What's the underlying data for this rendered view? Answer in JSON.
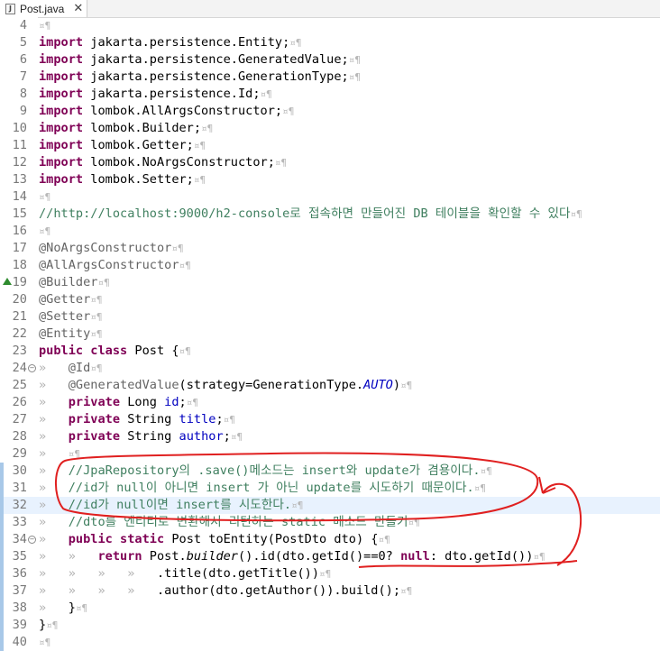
{
  "tab": {
    "title": "Post.java",
    "close_glyph": "✕",
    "icon": "java-file-icon"
  },
  "code_lines": [
    {
      "n": "4",
      "fold": false,
      "segments": []
    },
    {
      "n": "5",
      "fold": false,
      "segments": [
        {
          "t": "import",
          "c": "kw"
        },
        {
          "t": " jakarta.persistence.Entity;"
        }
      ]
    },
    {
      "n": "6",
      "fold": false,
      "segments": [
        {
          "t": "import",
          "c": "kw"
        },
        {
          "t": " jakarta.persistence.GeneratedValue;"
        }
      ]
    },
    {
      "n": "7",
      "fold": false,
      "segments": [
        {
          "t": "import",
          "c": "kw"
        },
        {
          "t": " jakarta.persistence.GenerationType;"
        }
      ]
    },
    {
      "n": "8",
      "fold": false,
      "segments": [
        {
          "t": "import",
          "c": "kw"
        },
        {
          "t": " jakarta.persistence.Id;"
        }
      ]
    },
    {
      "n": "9",
      "fold": false,
      "segments": [
        {
          "t": "import",
          "c": "kw"
        },
        {
          "t": " lombok.AllArgsConstructor;"
        }
      ]
    },
    {
      "n": "10",
      "fold": false,
      "segments": [
        {
          "t": "import",
          "c": "kw"
        },
        {
          "t": " lombok.Builder;"
        }
      ]
    },
    {
      "n": "11",
      "fold": false,
      "segments": [
        {
          "t": "import",
          "c": "kw"
        },
        {
          "t": " lombok.Getter;"
        }
      ]
    },
    {
      "n": "12",
      "fold": false,
      "segments": [
        {
          "t": "import",
          "c": "kw"
        },
        {
          "t": " lombok.NoArgsConstructor;"
        }
      ]
    },
    {
      "n": "13",
      "fold": false,
      "segments": [
        {
          "t": "import",
          "c": "kw"
        },
        {
          "t": " lombok.Setter;"
        }
      ]
    },
    {
      "n": "14",
      "fold": false,
      "segments": []
    },
    {
      "n": "15",
      "fold": false,
      "segments": [
        {
          "t": "//http://localhost:9000/h2-console로 접속하면 만들어진 DB 테이블을 확인할 수 있다",
          "c": "cm"
        }
      ]
    },
    {
      "n": "16",
      "fold": false,
      "segments": []
    },
    {
      "n": "17",
      "fold": false,
      "segments": [
        {
          "t": "@NoArgsConstructor",
          "c": "an"
        }
      ]
    },
    {
      "n": "18",
      "fold": false,
      "segments": [
        {
          "t": "@AllArgsConstructor",
          "c": "an"
        }
      ]
    },
    {
      "n": "19",
      "fold": false,
      "override": true,
      "segments": [
        {
          "t": "@Builder",
          "c": "an"
        }
      ]
    },
    {
      "n": "20",
      "fold": false,
      "segments": [
        {
          "t": "@Getter",
          "c": "an"
        }
      ]
    },
    {
      "n": "21",
      "fold": false,
      "segments": [
        {
          "t": "@Setter",
          "c": "an"
        }
      ]
    },
    {
      "n": "22",
      "fold": false,
      "segments": [
        {
          "t": "@Entity",
          "c": "an"
        }
      ]
    },
    {
      "n": "23",
      "fold": false,
      "segments": [
        {
          "t": "public",
          "c": "kw"
        },
        {
          "t": " "
        },
        {
          "t": "class",
          "c": "kw"
        },
        {
          "t": " Post {"
        }
      ]
    },
    {
      "n": "24",
      "fold": true,
      "segments": [
        {
          "t": "»   ",
          "c": "ws"
        },
        {
          "t": "@Id",
          "c": "an"
        }
      ]
    },
    {
      "n": "25",
      "fold": false,
      "segments": [
        {
          "t": "»   ",
          "c": "ws"
        },
        {
          "t": "@GeneratedValue",
          "c": "an"
        },
        {
          "t": "(strategy=GenerationType."
        },
        {
          "t": "AUTO",
          "c": "fd it"
        },
        {
          "t": ")"
        }
      ]
    },
    {
      "n": "26",
      "fold": false,
      "segments": [
        {
          "t": "»   ",
          "c": "ws"
        },
        {
          "t": "private",
          "c": "kw"
        },
        {
          "t": " Long "
        },
        {
          "t": "id",
          "c": "fd"
        },
        {
          "t": ";"
        }
      ]
    },
    {
      "n": "27",
      "fold": false,
      "segments": [
        {
          "t": "»   ",
          "c": "ws"
        },
        {
          "t": "private",
          "c": "kw"
        },
        {
          "t": " String "
        },
        {
          "t": "title",
          "c": "fd"
        },
        {
          "t": ";"
        }
      ]
    },
    {
      "n": "28",
      "fold": false,
      "segments": [
        {
          "t": "»   ",
          "c": "ws"
        },
        {
          "t": "private",
          "c": "kw"
        },
        {
          "t": " String "
        },
        {
          "t": "author",
          "c": "fd"
        },
        {
          "t": ";"
        }
      ]
    },
    {
      "n": "29",
      "fold": false,
      "segments": [
        {
          "t": "»   ",
          "c": "ws"
        }
      ]
    },
    {
      "n": "30",
      "fold": false,
      "changed": true,
      "segments": [
        {
          "t": "»   ",
          "c": "ws"
        },
        {
          "t": "//JpaRepository의 .save()메소드는 insert와 update가 겸용이다.",
          "c": "cm"
        }
      ]
    },
    {
      "n": "31",
      "fold": false,
      "changed": true,
      "segments": [
        {
          "t": "»   ",
          "c": "ws"
        },
        {
          "t": "//id가 null이 아니면 insert 가 아닌 update를 시도하기 때문이다.",
          "c": "cm"
        }
      ]
    },
    {
      "n": "32",
      "fold": false,
      "changed": true,
      "current": true,
      "segments": [
        {
          "t": "»   ",
          "c": "ws"
        },
        {
          "t": "//id가 null이면 insert를 시도한다.",
          "c": "cm"
        }
      ]
    },
    {
      "n": "33",
      "fold": false,
      "changed": true,
      "segments": [
        {
          "t": "»   ",
          "c": "ws"
        },
        {
          "t": "//dto를 엔티티로 변환해서 리턴하는 static 메소드 만들기",
          "c": "cm"
        }
      ]
    },
    {
      "n": "34",
      "fold": true,
      "changed": true,
      "segments": [
        {
          "t": "»   ",
          "c": "ws"
        },
        {
          "t": "public",
          "c": "kw"
        },
        {
          "t": " "
        },
        {
          "t": "static",
          "c": "kw"
        },
        {
          "t": " Post toEntity(PostDto dto) {"
        }
      ]
    },
    {
      "n": "35",
      "fold": false,
      "changed": true,
      "segments": [
        {
          "t": "»   »   ",
          "c": "ws"
        },
        {
          "t": "return",
          "c": "kw"
        },
        {
          "t": " Post."
        },
        {
          "t": "builder",
          "c": "it"
        },
        {
          "t": "().id(dto.getId()==0? "
        },
        {
          "t": "null",
          "c": "kw"
        },
        {
          "t": ": dto.getId())"
        }
      ]
    },
    {
      "n": "36",
      "fold": false,
      "changed": true,
      "segments": [
        {
          "t": "»   »   »   »   ",
          "c": "ws"
        },
        {
          "t": ".title(dto.getTitle())"
        }
      ]
    },
    {
      "n": "37",
      "fold": false,
      "changed": true,
      "segments": [
        {
          "t": "»   »   »   »   ",
          "c": "ws"
        },
        {
          "t": ".author(dto.getAuthor()).build();"
        }
      ]
    },
    {
      "n": "38",
      "fold": false,
      "changed": true,
      "segments": [
        {
          "t": "»   ",
          "c": "ws"
        },
        {
          "t": "}"
        }
      ]
    },
    {
      "n": "39",
      "fold": false,
      "changed": true,
      "segments": [
        {
          "t": "}"
        }
      ]
    },
    {
      "n": "40",
      "fold": false,
      "changed": true,
      "segments": []
    }
  ],
  "eol_marker": "¤¶",
  "annotation_color": "#e02020"
}
